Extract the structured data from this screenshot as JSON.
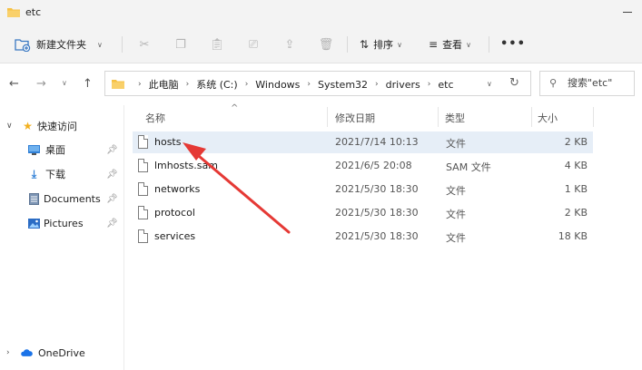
{
  "window": {
    "title": "etc"
  },
  "toolbar": {
    "new_folder_label": "新建文件夹",
    "sort_label": "排序",
    "view_label": "查看",
    "more_label": "•••"
  },
  "address": {
    "breadcrumb": [
      "此电脑",
      "系统 (C:)",
      "Windows",
      "System32",
      "drivers",
      "etc"
    ]
  },
  "search": {
    "placeholder": "搜索\"etc\""
  },
  "sidebar": {
    "quick_access_label": "快速访问",
    "items": [
      {
        "label": "桌面",
        "pinned": true
      },
      {
        "label": "下载",
        "pinned": true
      },
      {
        "label": "Documents",
        "pinned": true
      },
      {
        "label": "Pictures",
        "pinned": true
      }
    ],
    "onedrive_label": "OneDrive"
  },
  "columns": {
    "name": "名称",
    "date": "修改日期",
    "type": "类型",
    "size": "大小"
  },
  "files": [
    {
      "name": "hosts",
      "date": "2021/7/14 10:13",
      "type": "文件",
      "size": "2 KB",
      "selected": true
    },
    {
      "name": "lmhosts.sam",
      "date": "2021/6/5 20:08",
      "type": "SAM 文件",
      "size": "4 KB",
      "selected": false
    },
    {
      "name": "networks",
      "date": "2021/5/30 18:30",
      "type": "文件",
      "size": "1 KB",
      "selected": false
    },
    {
      "name": "protocol",
      "date": "2021/5/30 18:30",
      "type": "文件",
      "size": "2 KB",
      "selected": false
    },
    {
      "name": "services",
      "date": "2021/5/30 18:30",
      "type": "文件",
      "size": "18 KB",
      "selected": false
    }
  ],
  "colors": {
    "folder_yellow": "#f6c144",
    "selected_row": "#e6eef7",
    "annotation_arrow": "#e53935",
    "onedrive_blue": "#1a73e8"
  }
}
